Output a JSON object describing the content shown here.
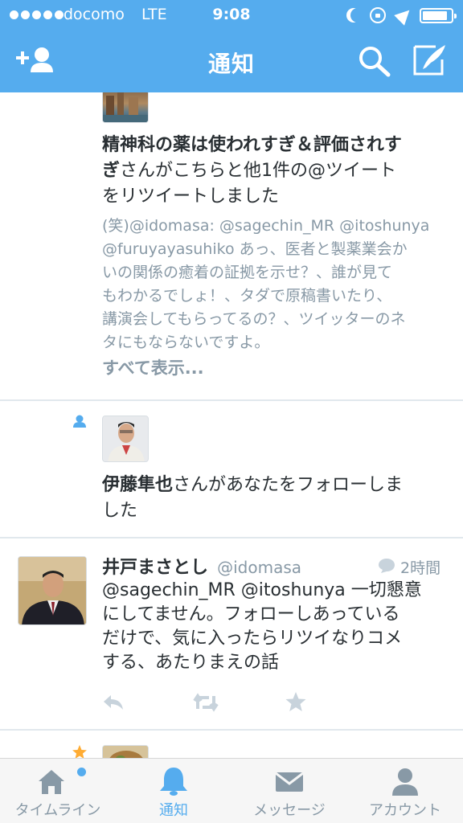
{
  "status_bar": {
    "carrier": "docomo",
    "network": "LTE",
    "time": "9:08",
    "icons": [
      "signal-dots",
      "moon-icon",
      "rotation-lock-icon",
      "location-icon",
      "battery-icon"
    ]
  },
  "nav": {
    "title": "通知",
    "left_icon": "add-user-icon",
    "right_icons": [
      "search-icon",
      "compose-icon"
    ]
  },
  "notifications": [
    {
      "type": "retweet",
      "user_name": "精神科の薬は使われすぎ＆評価されすぎ",
      "text_after": "さんがこちらと他1件の@ツイートをリツイートしました",
      "preview": "(笑)@idomasa: @sagechin_MR @itoshunya @furuyayasuhiko あっ、医者と製薬業会かいの関係の癒着の証拠を示せ？、誰が見てもわかるでしょ！、タダで原稿書いたり、講演会してもらってるの？、ツイッターのネタにもならないですよ。",
      "preview_lines": [
        "(笑)@idomasa: @sagechin_MR @itoshunya",
        "@furuyayasuhiko あっ、医者と製薬業会か",
        "いの関係の癒着の証拠を示せ？、誰が見て",
        "もわかるでしょ！、タダで原稿書いたり、",
        "講演会してもらってるの？、ツイッターのネ",
        "タにもならないですよ。"
      ],
      "show_all": "すべて表示..."
    },
    {
      "type": "follow",
      "user_name": "伊藤隼也",
      "text_line1_after": "さんがあなたをフォローしま",
      "text_line2": "した"
    },
    {
      "type": "tweet",
      "display_name": "井戸まさとし",
      "handle": "@idomasa",
      "time": "2時間",
      "lines": [
        "@sagechin_MR @itoshunya 一切懇意",
        "にしてません。フォローしあっている",
        "だけで、気に入ったらリツイなりコメ",
        "する、あたりまえの話"
      ]
    },
    {
      "type": "favorite"
    }
  ],
  "tabs": [
    {
      "label": "タイムライン",
      "icon": "home-icon",
      "active": false,
      "badge": true
    },
    {
      "label": "通知",
      "icon": "bell-icon",
      "active": true
    },
    {
      "label": "メッセージ",
      "icon": "envelope-icon",
      "active": false
    },
    {
      "label": "アカウント",
      "icon": "person-icon",
      "active": false
    }
  ],
  "colors": {
    "brand_blue": "#55acee",
    "text_dark": "#292f33",
    "text_gray": "#8899a6",
    "star_orange": "#ffac33",
    "divider": "#e1e8ed"
  }
}
